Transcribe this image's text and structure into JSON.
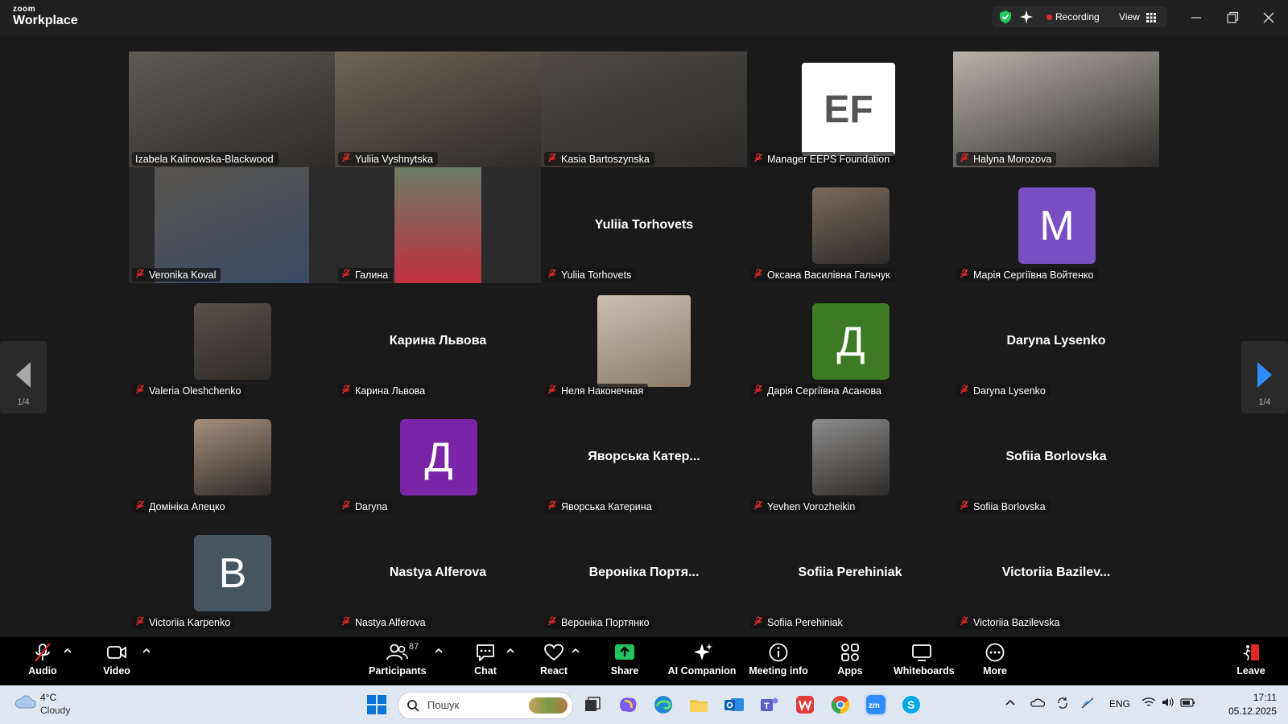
{
  "app": {
    "logo_line1": "zoom",
    "logo_line2": "Workplace"
  },
  "status": {
    "recording_label": "Recording",
    "view_label": "View"
  },
  "pager": {
    "left": "1/4",
    "right": "1/4"
  },
  "tiles": [
    {
      "name": "Izabela Kalinowska-Blackwood",
      "kind": "video",
      "bg": "#5e5a55",
      "speaking": true,
      "muted": false
    },
    {
      "name": "Yuliia Vyshnytska",
      "kind": "video",
      "bg": "#6e6456",
      "muted": true
    },
    {
      "name": "Kasia Bartoszynska",
      "kind": "video",
      "bg": "#4f4a44",
      "muted": true
    },
    {
      "name": "Manager EEPS Foundation",
      "kind": "logo",
      "avatar_text": "EF",
      "muted": true
    },
    {
      "name": "Halyna Morozova",
      "kind": "video",
      "bg": "#b8b2aa",
      "muted": true
    },
    {
      "name": "Veronika Koval",
      "kind": "video-narrow",
      "bg": "#5a564f",
      "muted": true
    },
    {
      "name": "Галина",
      "kind": "video-narrow2",
      "bg": "#6b7d62",
      "muted": true
    },
    {
      "name": "Yuliia Torhovets",
      "kind": "text",
      "display": "Yuliia Torhovets",
      "muted": true
    },
    {
      "name": "Оксана Василівна Гальчук",
      "kind": "photo-avatar",
      "bg": "#7a6a5c",
      "muted": true
    },
    {
      "name": "Марія Сергіївна Войтенко",
      "kind": "letter",
      "avatar_text": "M",
      "color": "#7b4fc2",
      "muted": true
    },
    {
      "name": "Valeria Oleshchenko",
      "kind": "photo-avatar",
      "bg": "#5a5048",
      "muted": true
    },
    {
      "name": "Карина Львова",
      "kind": "text",
      "display": "Карина Львова",
      "muted": true
    },
    {
      "name": "Неля Наконечная",
      "kind": "photo-avatar-wide",
      "bg": "#cdbfae",
      "muted": true
    },
    {
      "name": "Дарія Сергіївна Асанова",
      "kind": "letter",
      "avatar_text": "Д",
      "color": "#3d7a24",
      "muted": true
    },
    {
      "name": "Daryna Lysenko",
      "kind": "text",
      "display": "Daryna Lysenko",
      "muted": true
    },
    {
      "name": "Домініка Апецко",
      "kind": "photo-avatar",
      "bg": "#a58f7c",
      "muted": true
    },
    {
      "name": "Daryna",
      "kind": "letter",
      "avatar_text": "Д",
      "color": "#7a24a6",
      "muted": true
    },
    {
      "name": "Яворська Катерина",
      "kind": "text",
      "display": "Яворська Катер...",
      "muted": true
    },
    {
      "name": "Yevhen Vorozheikin",
      "kind": "photo-avatar",
      "bg": "#8c8c8c",
      "muted": true
    },
    {
      "name": "Sofiia Borlovska",
      "kind": "text",
      "display": "Sofiia Borlovska",
      "muted": true
    },
    {
      "name": "Victoriia Karpenko",
      "kind": "letter",
      "avatar_text": "B",
      "color": "#47555f",
      "muted": true
    },
    {
      "name": "Nastya Alferova",
      "kind": "text",
      "display": "Nastya Alferova",
      "muted": true
    },
    {
      "name": "Вероніка Портянко",
      "kind": "text",
      "display": "Вероніка Портя...",
      "muted": true
    },
    {
      "name": "Sofiia Perehiniak",
      "kind": "text",
      "display": "Sofiia Perehiniak",
      "muted": true
    },
    {
      "name": "Victoriia Bazilevska",
      "kind": "text",
      "display": "Victoriia Bazilev...",
      "muted": true
    }
  ],
  "toolbar": {
    "audio": "Audio",
    "video": "Video",
    "participants": "Participants",
    "participants_count": "87",
    "chat": "Chat",
    "react": "React",
    "share": "Share",
    "ai_companion": "AI Companion",
    "meeting_info": "Meeting info",
    "apps": "Apps",
    "whiteboards": "Whiteboards",
    "more": "More",
    "leave": "Leave"
  },
  "taskbar": {
    "temp": "4°C",
    "condition": "Cloudy",
    "search_placeholder": "Пошук",
    "lang": "ENG",
    "time": "17:11",
    "date": "05.12.2025"
  },
  "colors": {
    "speaking": "#2ad889",
    "share": "#22c55e",
    "leave": "#e02828",
    "accent_blue": "#2d8cff"
  }
}
